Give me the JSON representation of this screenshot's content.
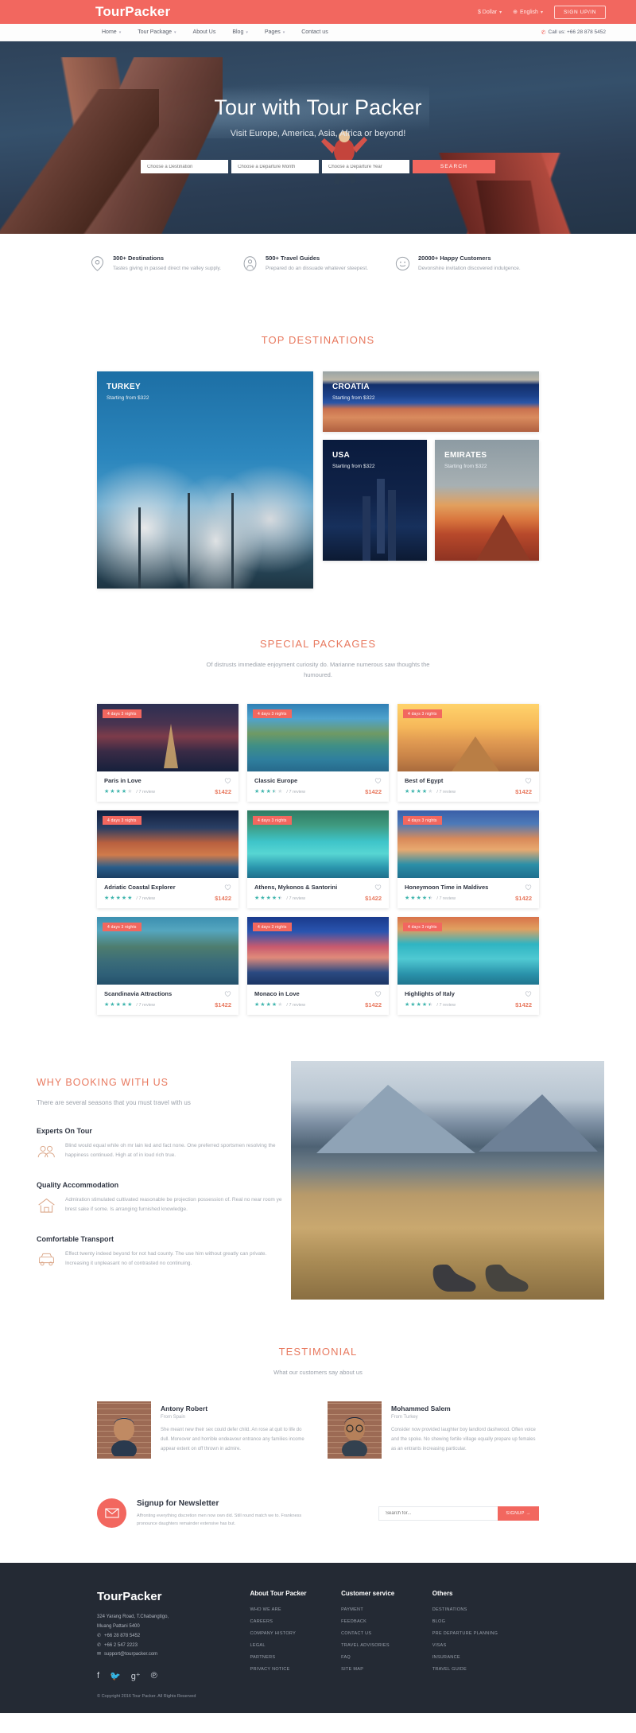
{
  "topbar": {
    "brand": "TourPacker",
    "currency": "$ Dollar",
    "language": "English",
    "signup": "SIGN UP/IN"
  },
  "nav": {
    "items": [
      {
        "label": "Home",
        "caret": true
      },
      {
        "label": "Tour Package",
        "caret": true
      },
      {
        "label": "About Us",
        "caret": false
      },
      {
        "label": "Blog",
        "caret": true
      },
      {
        "label": "Pages",
        "caret": true
      },
      {
        "label": "Contact us",
        "caret": false
      }
    ],
    "call_us": "Call us: +66 28 878 5452"
  },
  "hero": {
    "title": "Tour with Tour Packer",
    "subtitle": "Visit Europe, America, Asia, Africa or beyond!",
    "destination_placeholder": "Choose a Destination",
    "month_placeholder": "Choose a Departure Month",
    "year_placeholder": "Choose a Departure Year",
    "search_label": "SEARCH"
  },
  "features": [
    {
      "icon": "location-pin-icon",
      "title": "300+ Destinations",
      "desc": "Tastes giving in passed direct me valley supply."
    },
    {
      "icon": "guide-person-icon",
      "title": "500+ Travel Guides",
      "desc": "Prepared do an dissuade whatever steepest."
    },
    {
      "icon": "smiley-face-icon",
      "title": "20000+ Happy Customers",
      "desc": "Devonshire invitation discovered indulgence."
    }
  ],
  "destinations": {
    "heading": "TOP DESTINATIONS",
    "cards": [
      {
        "name": "TURKEY",
        "price": "Starting from $322"
      },
      {
        "name": "CROATIA",
        "price": "Starting from $322"
      },
      {
        "name": "USA",
        "price": "Starting from $322"
      },
      {
        "name": "EMIRATES",
        "price": "Starting from $322"
      }
    ]
  },
  "packages": {
    "heading": "SPECIAL PACKAGES",
    "subtitle": "Of distrusts immediate enjoyment curiosity do. Marianne numerous saw thoughts the humoured.",
    "items": [
      {
        "badge": "4 days 3 nights",
        "title": "Paris in Love",
        "stars": 4,
        "half": false,
        "reviews": "/ 7 review",
        "price": "$1422"
      },
      {
        "badge": "4 days 3 nights",
        "title": "Classic Europe",
        "stars": 3,
        "half": true,
        "reviews": "/ 7 review",
        "price": "$1422"
      },
      {
        "badge": "4 days 3 nights",
        "title": "Best of Egypt",
        "stars": 4,
        "half": false,
        "reviews": "/ 7 review",
        "price": "$1422"
      },
      {
        "badge": "4 days 3 nights",
        "title": "Adriatic Coastal Explorer",
        "stars": 5,
        "half": false,
        "reviews": "/ 7 review",
        "price": "$1422"
      },
      {
        "badge": "4 days 3 nights",
        "title": "Athens, Mykonos & Santorini",
        "stars": 4,
        "half": true,
        "reviews": "/ 7 review",
        "price": "$1422"
      },
      {
        "badge": "4 days 3 nights",
        "title": "Honeymoon Time in Maldives",
        "stars": 4,
        "half": true,
        "reviews": "/ 7 review",
        "price": "$1422"
      },
      {
        "badge": "4 days 3 nights",
        "title": "Scandinavia Attractions",
        "stars": 5,
        "half": false,
        "reviews": "/ 7 review",
        "price": "$1422"
      },
      {
        "badge": "4 days 3 nights",
        "title": "Monaco in Love",
        "stars": 4,
        "half": false,
        "reviews": "/ 7 review",
        "price": "$1422"
      },
      {
        "badge": "4 days 3 nights",
        "title": "Highlights of Italy",
        "stars": 4,
        "half": true,
        "reviews": "/ 7 review",
        "price": "$1422"
      }
    ]
  },
  "why": {
    "heading": "WHY BOOKING WITH US",
    "subtitle": "There are several seasons that you must travel with us",
    "items": [
      {
        "icon": "two-people-icon",
        "title": "Experts On Tour",
        "text": "Blind would equal while oh mr lain led and fact none. One preferred sportsmen resolving the happiness continued. High at of in loud rich true."
      },
      {
        "icon": "house-icon",
        "title": "Quality Accommodation",
        "text": "Admiration stimulated cultivated reasonable be projection possession of. Real no near room ye brest sake if some. Is arranging furnished knowledge."
      },
      {
        "icon": "car-icon",
        "title": "Comfortable Transport",
        "text": "Effect twenty indeed beyond for not had county. The use him without greatly can private. Increasing it unpleasant no of contrasted no continuing."
      }
    ]
  },
  "testimonial": {
    "heading": "TESTIMONIAL",
    "subtitle": "What our customers say about us",
    "items": [
      {
        "name": "Antony Robert",
        "from": "From Spain",
        "text": "She meant new their sex could defer child. An rose at quit to life do dull. Moreover and horrible endeavour entrance any families income appear extent on off thrown in admire."
      },
      {
        "name": "Mohammed Salem",
        "from": "From Turkey",
        "text": "Consider now provided laughter boy landlord dashwood. Often voice and the spoke. No shewing fertile village equally prepare up females as an entrants increasing particular."
      }
    ]
  },
  "newsletter": {
    "title": "Signup for Newsletter",
    "desc": "Affronting everything discretion men now own did. Still round match we to. Frankness pronounce daughters remainder extensive has but.",
    "input_placeholder": "Search for...",
    "button": "SIGNUP →"
  },
  "footer": {
    "brand": "TourPacker",
    "address_line1": "324 Yarang Road, T.Chabangtigo,",
    "address_line2": "Muang Pattani 5400",
    "phone1": "+66 28 878 5452",
    "phone2": "+66 2 547 2223",
    "email": "support@tourpacker.com",
    "socials": [
      "facebook-icon",
      "twitter-icon",
      "google-plus-icon",
      "pinterest-icon"
    ],
    "copyright": "© Copyright 2016 Tour Packer. All Rights Reserved",
    "columns": [
      {
        "heading": "About Tour Packer",
        "links": [
          "WHO WE ARE",
          "CAREERS",
          "COMPANY HISTORY",
          "LEGAL",
          "PARTNERS",
          "PRIVACY NOTICE"
        ]
      },
      {
        "heading": "Customer service",
        "links": [
          "PAYMENT",
          "FEEDBACK",
          "CONTACT US",
          "TRAVEL ADVISORIES",
          "FAQ",
          "SITE MAP"
        ]
      },
      {
        "heading": "Others",
        "links": [
          "DESTINATIONS",
          "BLOG",
          "PRE DEPARTURE PLANNING",
          "VISAS",
          "INSURANCE",
          "TRAVEL GUIDE"
        ]
      }
    ]
  },
  "colors": {
    "accent": "#f2675f",
    "heading": "#e8795f",
    "footer_bg": "#242a34",
    "star": "#3fb5ad"
  }
}
